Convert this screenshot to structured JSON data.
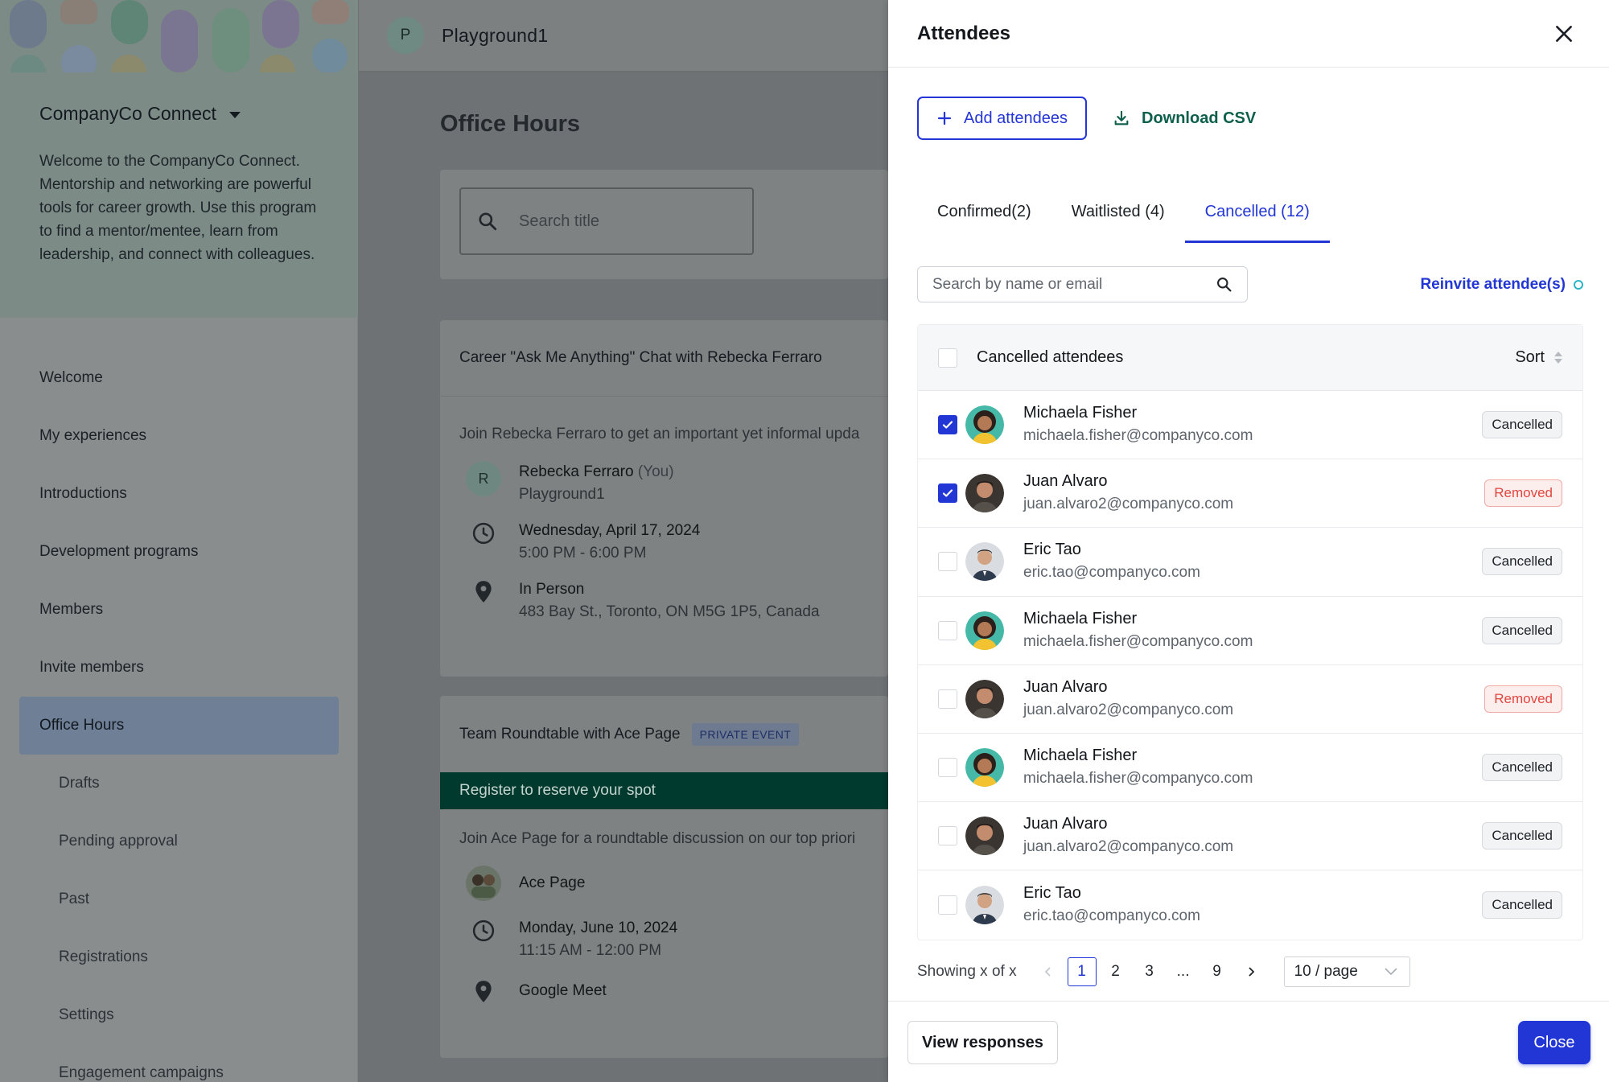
{
  "app": {
    "workspace": {
      "initial": "P",
      "name": "Playground1"
    },
    "company": {
      "name": "CompanyCo Connect"
    },
    "welcome": "Welcome to the CompanyCo Connect. Mentorship and networking are powerful tools for career growth. Use this program to find a mentor/mentee, learn from leadership, and connect with colleagues.",
    "nav": [
      {
        "label": "Welcome",
        "sub": false,
        "active": false
      },
      {
        "label": "My experiences",
        "sub": false,
        "active": false
      },
      {
        "label": "Introductions",
        "sub": false,
        "active": false
      },
      {
        "label": "Development programs",
        "sub": false,
        "active": false
      },
      {
        "label": "Members",
        "sub": false,
        "active": false
      },
      {
        "label": "Invite members",
        "sub": false,
        "active": false
      },
      {
        "label": "Office Hours",
        "sub": false,
        "active": true
      },
      {
        "label": "Drafts",
        "sub": true,
        "active": false
      },
      {
        "label": "Pending approval",
        "sub": true,
        "active": false
      },
      {
        "label": "Past",
        "sub": true,
        "active": false
      },
      {
        "label": "Registrations",
        "sub": true,
        "active": false
      },
      {
        "label": "Settings",
        "sub": true,
        "active": false
      },
      {
        "label": "Engagement campaigns",
        "sub": true,
        "active": false
      }
    ],
    "page_title": "Office Hours",
    "search_placeholder": "Search title",
    "events": [
      {
        "title": "Career \"Ask Me Anything\" Chat with Rebecka Ferraro",
        "description": "Join Rebecka Ferraro to get an important yet informal upda",
        "host_initial": "R",
        "host_name": "Rebecka Ferraro",
        "host_you": "(You)",
        "host_org": "Playground1",
        "date": "Wednesday, April 17, 2024",
        "time": "5:00 PM - 6:00 PM",
        "location": "In Person",
        "address": "483 Bay St., Toronto, ON M5G 1P5, Canada"
      },
      {
        "title": "Team Roundtable with Ace Page",
        "badge": "PRIVATE EVENT",
        "register": "Register to reserve your spot",
        "description": "Join Ace Page for a roundtable discussion on our top priori",
        "host_name": "Ace Page",
        "date": "Monday, June 10, 2024",
        "time": "11:15 AM - 12:00 PM",
        "location": "Google Meet"
      }
    ]
  },
  "drawer": {
    "title": "Attendees",
    "add_label": "Add attendees",
    "csv_label": "Download CSV",
    "tabs": [
      {
        "label": "Confirmed(2)",
        "active": false
      },
      {
        "label": "Waitlisted (4)",
        "active": false
      },
      {
        "label": "Cancelled (12)",
        "active": true
      }
    ],
    "search_placeholder": "Search by name or email",
    "reinvite_label": "Reinvite attendee(s)",
    "table": {
      "header": "Cancelled attendees",
      "sort_label": "Sort",
      "rows": [
        {
          "name": "Michaela Fisher",
          "email": "michaela.fisher@companyco.com",
          "status": "Cancelled",
          "checked": true,
          "avatar": "michaela"
        },
        {
          "name": "Juan Alvaro",
          "email": "juan.alvaro2@companyco.com",
          "status": "Removed",
          "checked": true,
          "avatar": "juan"
        },
        {
          "name": "Eric Tao",
          "email": "eric.tao@companyco.com",
          "status": "Cancelled",
          "checked": false,
          "avatar": "eric"
        },
        {
          "name": "Michaela Fisher",
          "email": "michaela.fisher@companyco.com",
          "status": "Cancelled",
          "checked": false,
          "avatar": "michaela"
        },
        {
          "name": "Juan Alvaro",
          "email": "juan.alvaro2@companyco.com",
          "status": "Removed",
          "checked": false,
          "avatar": "juan"
        },
        {
          "name": "Michaela Fisher",
          "email": "michaela.fisher@companyco.com",
          "status": "Cancelled",
          "checked": false,
          "avatar": "michaela"
        },
        {
          "name": "Juan Alvaro",
          "email": "juan.alvaro2@companyco.com",
          "status": "Cancelled",
          "checked": false,
          "avatar": "juan"
        },
        {
          "name": "Eric Tao",
          "email": "eric.tao@companyco.com",
          "status": "Cancelled",
          "checked": false,
          "avatar": "eric"
        }
      ]
    },
    "pagination": {
      "info": "Showing x of x",
      "pages": [
        "1",
        "2",
        "3",
        "...",
        "9"
      ],
      "current": "1",
      "per_page": "10 / page"
    },
    "footer": {
      "view_label": "View responses",
      "close_label": "Close"
    }
  },
  "colors": {
    "primary": "#2236d6",
    "csv_green": "#0c5f4a",
    "removed_red": "#e2463f",
    "register_bar": "#003a2e"
  },
  "icons": [
    "close-icon",
    "plus-icon",
    "download-icon",
    "search-icon",
    "clock-icon",
    "location-pin-icon",
    "chevron-left-icon",
    "chevron-right-icon",
    "chevron-down-icon",
    "check-icon",
    "sort-icon"
  ]
}
